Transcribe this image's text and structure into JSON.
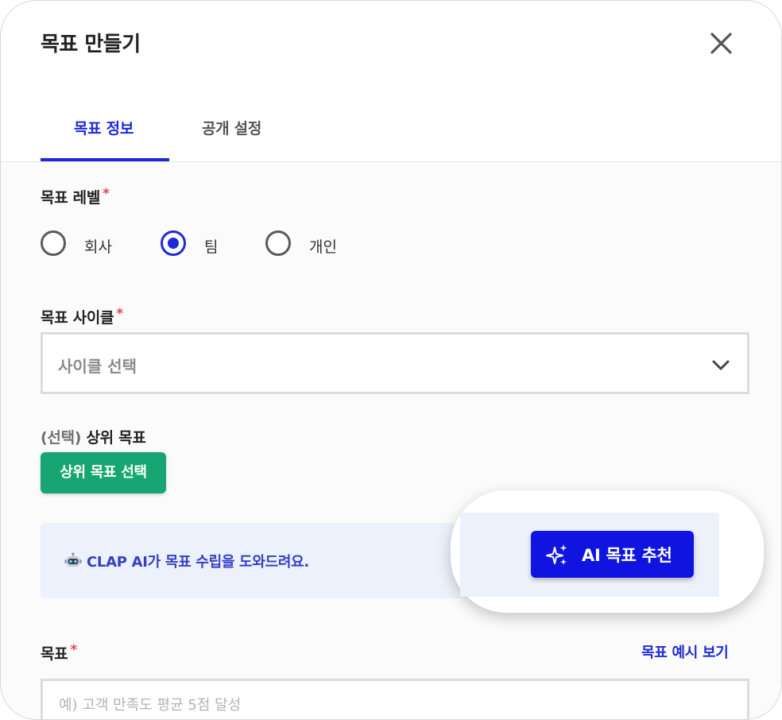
{
  "modal": {
    "title": "목표 만들기"
  },
  "tabs": [
    {
      "label": "목표 정보",
      "active": true
    },
    {
      "label": "공개 설정",
      "active": false
    }
  ],
  "goal_level": {
    "label": "목표 레벨",
    "required_mark": "*",
    "options": [
      {
        "label": "회사",
        "selected": false
      },
      {
        "label": "팀",
        "selected": true
      },
      {
        "label": "개인",
        "selected": false
      }
    ]
  },
  "goal_cycle": {
    "label": "목표 사이클",
    "required_mark": "*",
    "placeholder": "사이클 선택"
  },
  "parent_goal": {
    "optional_prefix": "(선택)",
    "label": "상위 목표",
    "button_label": "상위 목표 선택"
  },
  "ai_banner": {
    "icon": "robot-icon",
    "text": "CLAP AI가 목표 수립을 도와드려요.",
    "button_label": "AI 목표 추천",
    "button_icon": "sparkles-icon"
  },
  "goal": {
    "label": "목표",
    "required_mark": "*",
    "example_link": "목표 예시 보기",
    "placeholder": "예) 고객 만족도 평균 5점 달성"
  },
  "colors": {
    "accent": "#1f2ad6",
    "ai_button": "#0f14e0",
    "green_button": "#17a673",
    "required": "#e5484d",
    "banner_bg": "#edf1fb"
  }
}
